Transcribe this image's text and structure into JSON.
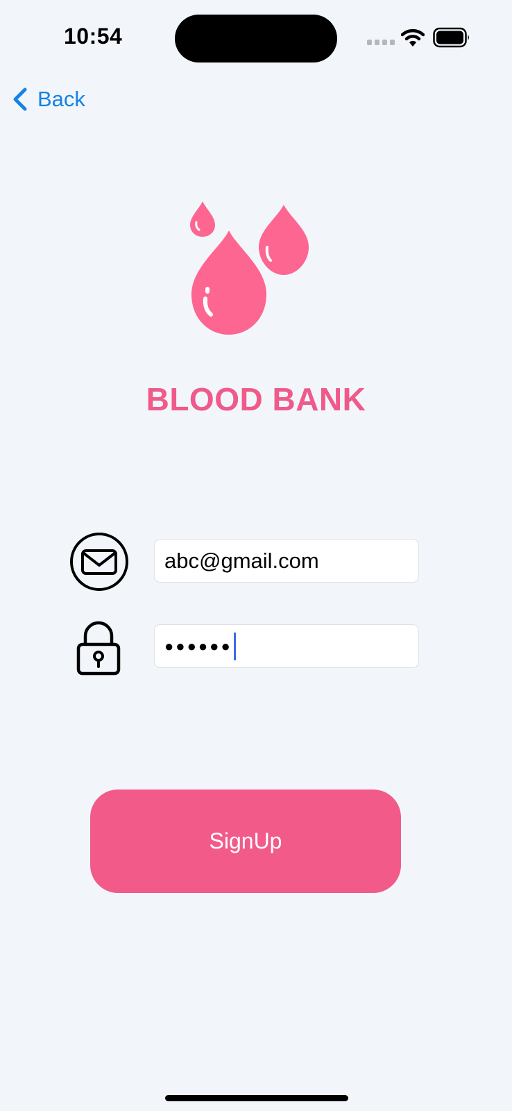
{
  "status_bar": {
    "time": "10:54"
  },
  "nav": {
    "back_label": "Back"
  },
  "app": {
    "title": "BLOOD BANK",
    "logo_icon": "blood-drops-icon",
    "brand_color": "#ef5a8a"
  },
  "form": {
    "email": {
      "icon": "mail-icon",
      "value": "abc@gmail.com"
    },
    "password": {
      "icon": "lock-icon",
      "masked_value": "●●●●●●"
    }
  },
  "actions": {
    "signup_label": "SignUp",
    "signup_color": "#f25a8a"
  },
  "colors": {
    "background": "#f2f6fa",
    "link": "#1682e4"
  }
}
